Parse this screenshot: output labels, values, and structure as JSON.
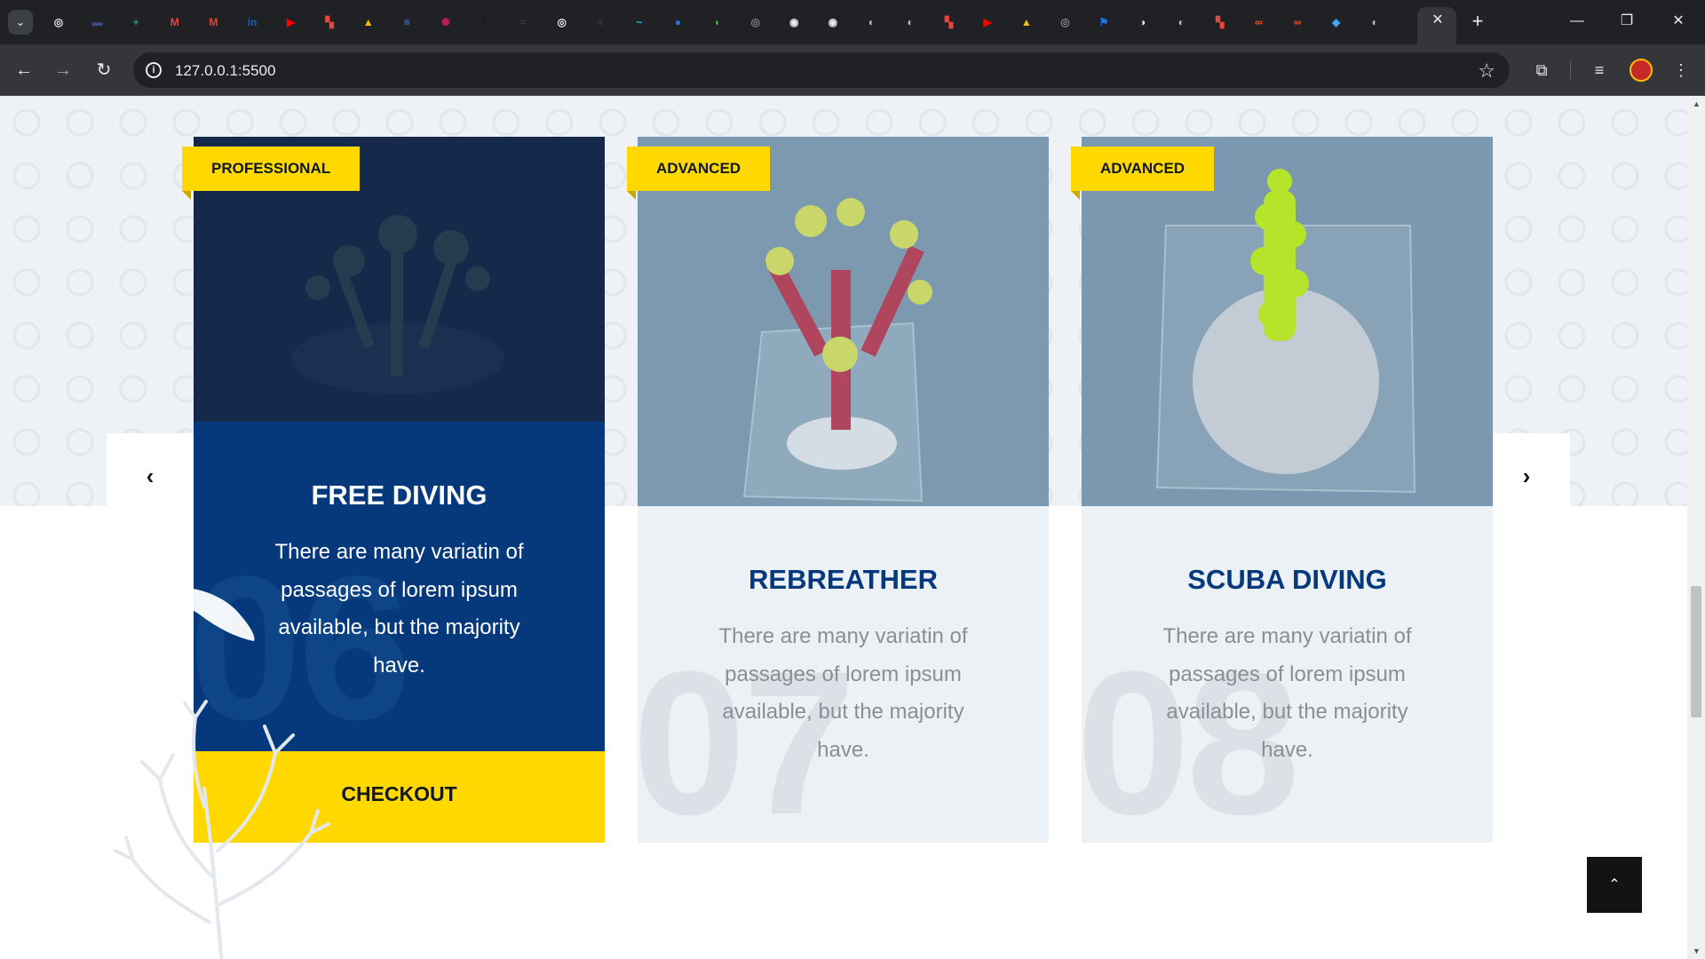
{
  "browser": {
    "url": "127.0.0.1:5500",
    "tab_favicons": [
      {
        "icon": "openai-icon",
        "color": "#e8eaed",
        "glyph": "◎"
      },
      {
        "icon": "bar-icon",
        "color": "#3c4e8c",
        "glyph": "▬"
      },
      {
        "icon": "sheets-icon",
        "color": "#1ea362",
        "glyph": "+"
      },
      {
        "icon": "gmail-icon",
        "color": "#ea4335",
        "glyph": "M"
      },
      {
        "icon": "gmail-icon",
        "color": "#ea4335",
        "glyph": "M"
      },
      {
        "icon": "linkedin-icon",
        "color": "#0a66c2",
        "glyph": "in"
      },
      {
        "icon": "youtube-icon",
        "color": "#ff0000",
        "glyph": "▶"
      },
      {
        "icon": "figma-icon",
        "color": "#e9463d",
        "glyph": "▚"
      },
      {
        "icon": "drive-icon",
        "color": "#fbbc04",
        "glyph": "▲"
      },
      {
        "icon": "docs-icon",
        "color": "#4285f4",
        "glyph": "≡"
      },
      {
        "icon": "react-icon",
        "color": "#c2185b",
        "glyph": "✺"
      },
      {
        "icon": "bolt-icon",
        "color": "#1b1b1b",
        "glyph": "ϟ"
      },
      {
        "icon": "wave-icon",
        "color": "#303a52",
        "glyph": "≈"
      },
      {
        "icon": "openai-icon",
        "color": "#e8eaed",
        "glyph": "◎"
      },
      {
        "icon": "leaf-icon",
        "color": "#2e2e2e",
        "glyph": "❦"
      },
      {
        "icon": "tailwind-icon",
        "color": "#38bdf8",
        "glyph": "~"
      },
      {
        "icon": "circle-icon",
        "color": "#1a73e8",
        "glyph": "●"
      },
      {
        "icon": "mongodb-icon",
        "color": "#4caf50",
        "glyph": "◖"
      },
      {
        "icon": "openai-icon",
        "color": "#80868b",
        "glyph": "◎"
      },
      {
        "icon": "github-icon",
        "color": "#e8eaed",
        "glyph": "◉"
      },
      {
        "icon": "github-icon",
        "color": "#e8eaed",
        "glyph": "◉"
      },
      {
        "icon": "globe-icon",
        "color": "#bdc1c6",
        "glyph": "◐"
      },
      {
        "icon": "globe-icon",
        "color": "#bdc1c6",
        "glyph": "◐"
      },
      {
        "icon": "figma-icon",
        "color": "#e9463d",
        "glyph": "▚"
      },
      {
        "icon": "youtube-icon",
        "color": "#ff0000",
        "glyph": "▶"
      },
      {
        "icon": "drive-icon",
        "color": "#fbbc04",
        "glyph": "▲"
      },
      {
        "icon": "openai-icon",
        "color": "#80868b",
        "glyph": "◎"
      },
      {
        "icon": "flag-icon",
        "color": "#1a73e8",
        "glyph": "⚑"
      },
      {
        "icon": "chrome-icon",
        "color": "#e8eaed",
        "glyph": "◑"
      },
      {
        "icon": "globe-icon",
        "color": "#bdc1c6",
        "glyph": "◐"
      },
      {
        "icon": "figma-icon",
        "color": "#e9463d",
        "glyph": "▚"
      },
      {
        "icon": "link-icon",
        "color": "#f4511e",
        "glyph": "∞"
      },
      {
        "icon": "link-icon",
        "color": "#f4511e",
        "glyph": "∞"
      },
      {
        "icon": "diamond-icon",
        "color": "#42a5f5",
        "glyph": "◆"
      },
      {
        "icon": "globe-icon",
        "color": "#bdc1c6",
        "glyph": "◐"
      }
    ]
  },
  "carousel": {
    "prev_glyph": "‹",
    "next_glyph": "›",
    "cards": [
      {
        "badge": "PROFESSIONAL",
        "number": "06",
        "title": "FREE DIVING",
        "text": "There are many variatin of passages of lorem ipsum available, but the majority have.",
        "button": "CHECKOUT",
        "active": true
      },
      {
        "badge": "ADVANCED",
        "number": "07",
        "title": "REBREATHER",
        "text": "There are many variatin of passages of lorem ipsum available, but the majority have.",
        "active": false
      },
      {
        "badge": "ADVANCED",
        "number": "08",
        "title": "SCUBA DIVING",
        "text": "There are many variatin of passages of lorem ipsum available, but the majority have.",
        "active": false
      }
    ]
  },
  "scroll_top": "⌃",
  "colors": {
    "accent_yellow": "#ffd800",
    "brand_blue": "#05397b",
    "card_grey": "#ecf1f5"
  }
}
